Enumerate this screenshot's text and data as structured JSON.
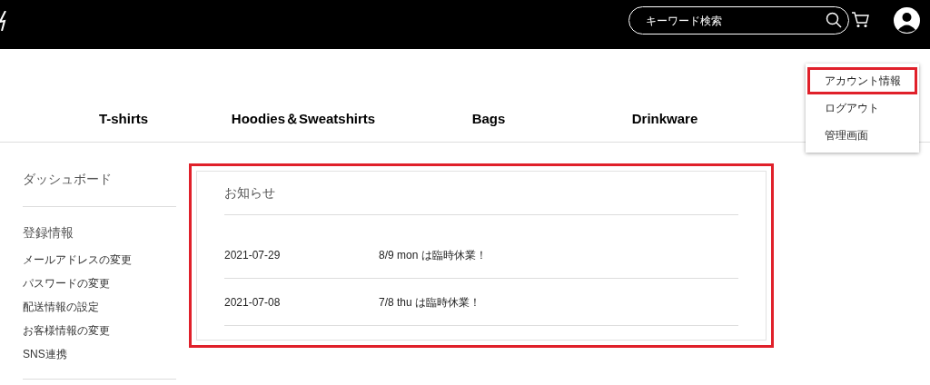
{
  "header": {
    "search": {
      "placeholder": "キーワード検索"
    },
    "account_menu": [
      {
        "label": "アカウント情報",
        "highlighted": true
      },
      {
        "label": "ログアウト",
        "highlighted": false
      },
      {
        "label": "管理画面",
        "highlighted": false
      }
    ]
  },
  "nav": [
    "T-shirts",
    "Hoodies＆Sweatshirts",
    "Bags",
    "Drinkware"
  ],
  "sidebar": {
    "sections": [
      {
        "title": "ダッシュボード"
      },
      {
        "title": "登録情報",
        "items": [
          "メールアドレスの変更",
          "パスワードの変更",
          "配送情報の設定",
          "お客様情報の変更",
          "SNS連携"
        ]
      }
    ]
  },
  "notices": {
    "title": "お知らせ",
    "highlighted": true,
    "rows": [
      {
        "date": "2021-07-29",
        "text": "8/9 mon は臨時休業！"
      },
      {
        "date": "2021-07-08",
        "text": "7/8 thu は臨時休業！"
      }
    ]
  }
}
